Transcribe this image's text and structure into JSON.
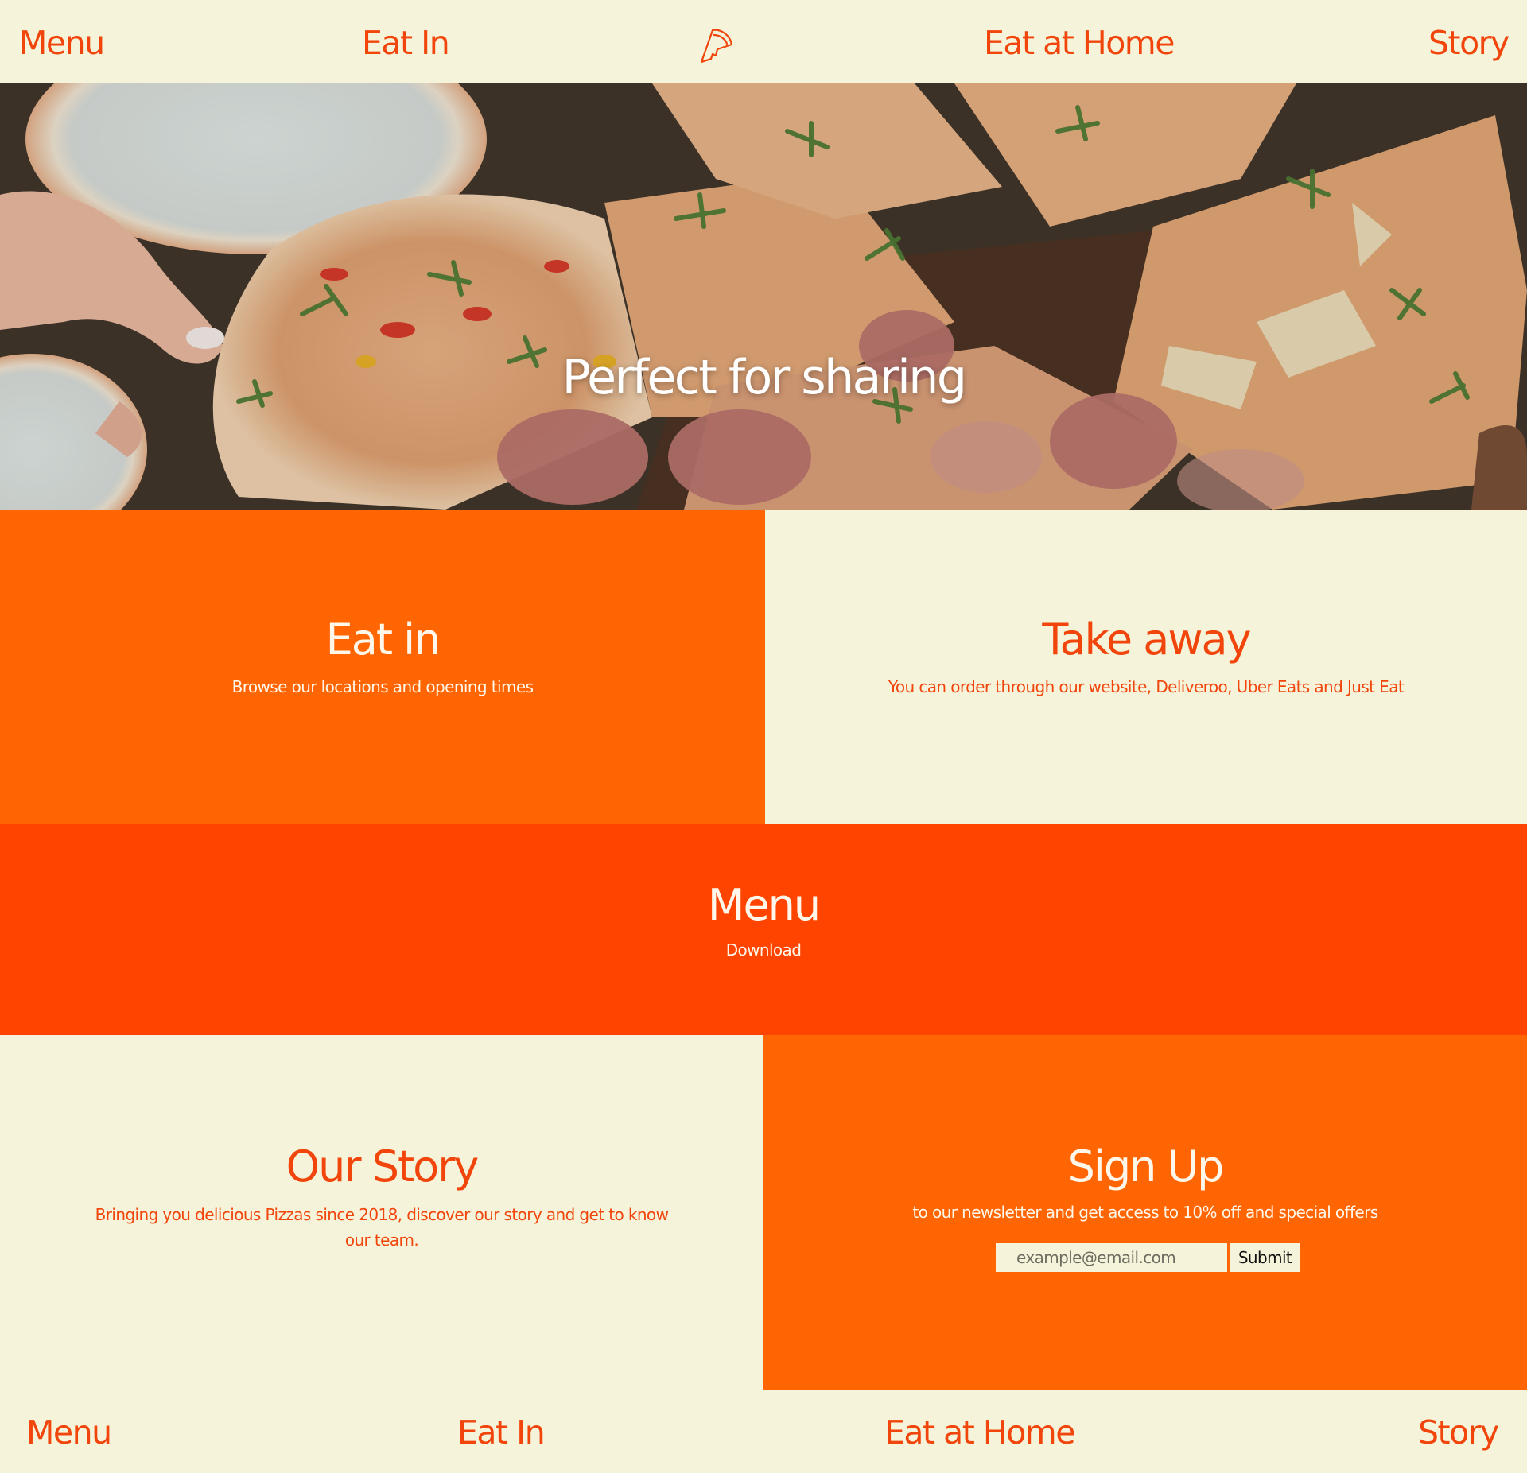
{
  "nav": {
    "menu": "Menu",
    "eat_in": "Eat In",
    "eat_at_home": "Eat at Home",
    "story": "Story",
    "logo_icon": "pizza-slice-icon"
  },
  "hero": {
    "title": "Perfect for sharing"
  },
  "eat_in": {
    "title": "Eat in",
    "text": "Browse our locations and opening times"
  },
  "take_away": {
    "title": "Take away",
    "text": "You can order through our website, Deliveroo, Uber Eats and Just Eat"
  },
  "menu_section": {
    "title": "Menu",
    "link": "Download"
  },
  "our_story": {
    "title": "Our Story",
    "text": "Bringing you delicious Pizzas since 2018, discover our story and get to know our team."
  },
  "sign_up": {
    "title": "Sign Up",
    "text": "to our newsletter and get access to 10% off and special offers",
    "email_placeholder": "example@email.com",
    "submit": "Submit"
  },
  "footer_nav": {
    "menu": "Menu",
    "eat_in": "Eat In",
    "eat_at_home": "Eat at Home",
    "story": "Story"
  },
  "colors": {
    "cream": "#f5f4da",
    "orange": "#ff6503",
    "red_orange": "#ff4400",
    "text_accent": "#f1450c"
  }
}
